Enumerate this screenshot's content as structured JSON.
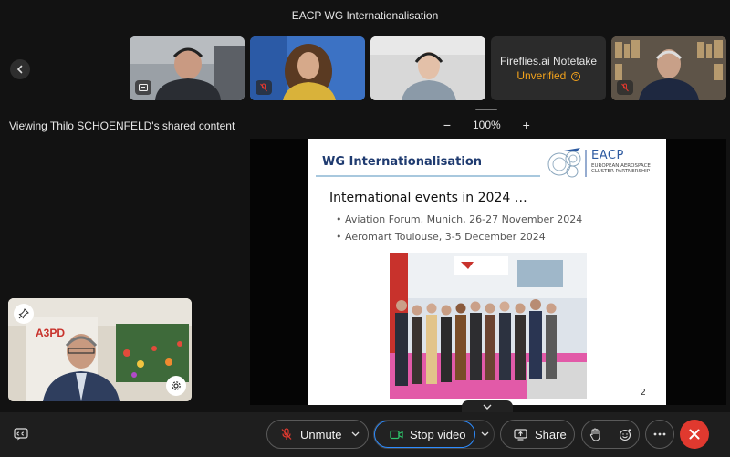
{
  "meeting": {
    "title": "EACP WG Internationalisation"
  },
  "participants": {
    "fireflies": {
      "name": "Fireflies.ai Notetake",
      "status": "Unverified"
    }
  },
  "share": {
    "viewing_text": "Viewing Thilo SCHOENFELD's shared content",
    "zoom_level": "100%",
    "zoom_out": "−",
    "zoom_in": "+"
  },
  "slide": {
    "header": "WG Internationalisation",
    "logo_text": "EACP",
    "logo_subtitle": "EUROPEAN AEROSPACE CLUSTER PARTNERSHIP",
    "title": "International events in 2024 …",
    "bullets": [
      "Aviation Forum, Munich, 26-27 November 2024",
      "Aeromart Toulouse, 3-5 December 2024"
    ],
    "page_number": "2"
  },
  "toolbar": {
    "unmute_label": "Unmute",
    "stop_video_label": "Stop video",
    "share_label": "Share"
  },
  "colors": {
    "accent_blue": "#2d8cff",
    "end_call_red": "#e0392f",
    "unverified_orange": "#f2a21c",
    "muted_red": "#e0392f"
  }
}
